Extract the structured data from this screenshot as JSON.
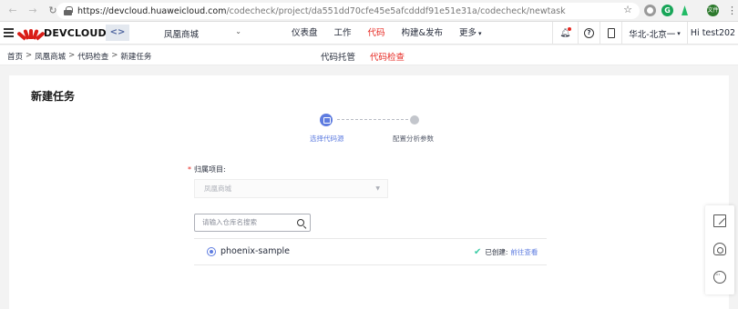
{
  "browser": {
    "url_host": "https://devcloud.huaweicloud.com",
    "url_path": "/codecheck/project/da551dd70cfe45e5afcdddf91e51e31a/codecheck/newtask",
    "ext_badge": "文件"
  },
  "appbar": {
    "logo_text": "DEVCLOUD",
    "project_icon_text": "<>",
    "project_name": "凤凰商城",
    "nav": [
      {
        "label": "仪表盘"
      },
      {
        "label": "工作"
      },
      {
        "label": "代码"
      },
      {
        "label": "构建&发布"
      },
      {
        "label": "更多"
      }
    ],
    "region": "华北-北京一",
    "user": "Hi test202"
  },
  "breadcrumb": [
    "首页",
    "凤凰商城",
    "代码检查",
    "新建任务"
  ],
  "subtabs": [
    {
      "label": "代码托管"
    },
    {
      "label": "代码检查"
    }
  ],
  "page": {
    "title": "新建任务",
    "steps": [
      {
        "label": "选择代码源"
      },
      {
        "label": "配置分析参数"
      }
    ],
    "project_field": {
      "label": "归属项目:",
      "value": "凤凰商城"
    },
    "search": {
      "placeholder": "请输入仓库名搜索"
    },
    "repo": {
      "name": "phoenix-sample",
      "status": "已创建:",
      "link": "前往查看"
    }
  },
  "colors": {
    "accent": "#5e7ce0",
    "brand_red": "#e6261f",
    "success": "#3dcca6"
  }
}
